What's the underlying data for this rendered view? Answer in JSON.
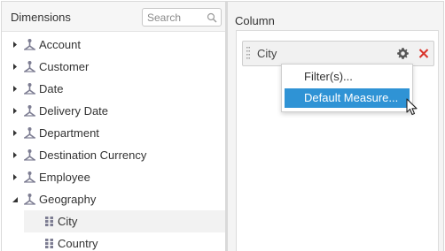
{
  "left_panel": {
    "title": "Dimensions",
    "search_placeholder": "Search",
    "tree": [
      {
        "label": "Account",
        "expanded": false
      },
      {
        "label": "Customer",
        "expanded": false
      },
      {
        "label": "Date",
        "expanded": false
      },
      {
        "label": "Delivery Date",
        "expanded": false
      },
      {
        "label": "Department",
        "expanded": false
      },
      {
        "label": "Destination Currency",
        "expanded": false
      },
      {
        "label": "Employee",
        "expanded": false
      },
      {
        "label": "Geography",
        "expanded": true
      },
      {
        "label": "City"
      },
      {
        "label": "Country"
      }
    ]
  },
  "right_panel": {
    "title": "Column",
    "pill": {
      "label": "City"
    }
  },
  "context_menu": {
    "items": [
      "Filter(s)...",
      "Default Measure..."
    ],
    "highlighted_index": 1
  },
  "colors": {
    "highlight": "#2f93d5",
    "close_icon": "#d9342b",
    "icon_grey": "#6b6b7a"
  },
  "icons": {
    "search": "search-icon",
    "dimension": "dimension-hierarchy-icon",
    "member": "grid-member-icon",
    "gear": "gear-icon",
    "close": "close-icon",
    "grip": "drag-grip-icon",
    "cursor": "mouse-pointer-icon"
  }
}
